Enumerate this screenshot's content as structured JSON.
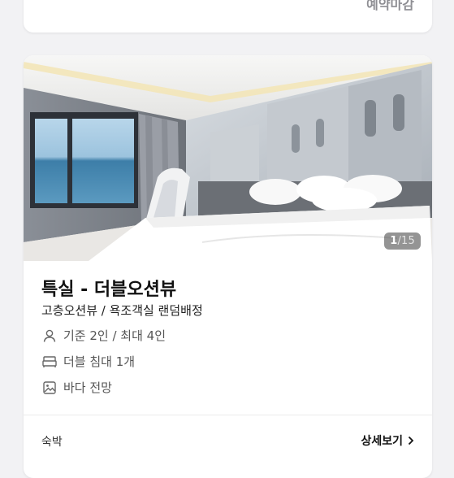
{
  "top_card": {
    "status": "예약마감"
  },
  "room": {
    "photo_counter": {
      "current": "1",
      "total": "/15"
    },
    "title": "특실 - 더블오션뷰",
    "subtitle": "고층오션뷰 / 욕조객실 랜덤배정",
    "features": [
      {
        "icon": "person-icon",
        "text": "기준 2인 / 최대 4인"
      },
      {
        "icon": "bed-icon",
        "text": "더블 침대 1개"
      },
      {
        "icon": "image-icon",
        "text": "바다 전망"
      }
    ],
    "stay_type": "숙박",
    "detail_link": "상세보기"
  },
  "colors": {
    "muted_text": "#8e8e93",
    "card_bg": "#ffffff",
    "page_bg": "#f2f2f4"
  }
}
